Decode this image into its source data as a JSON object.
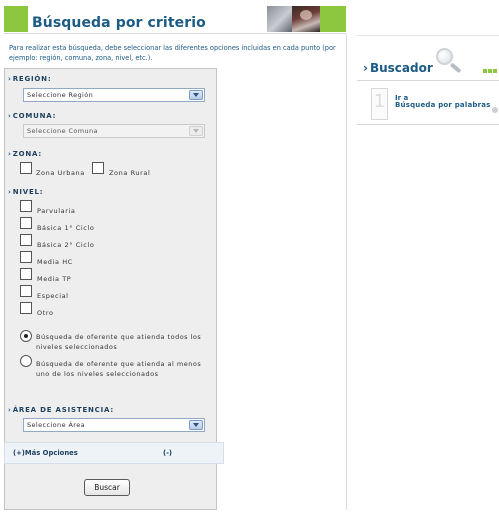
{
  "header": {
    "title": "Búsqueda por criterio",
    "instructions": "Para realizar esta búsqueda, debe seleccionar las diferentes opciones incluidas en cada punto (por ejemplo: región, comuna, zona, nivel, etc.)."
  },
  "form": {
    "region": {
      "label": "REGIÓN:",
      "selected": "Seleccione Región",
      "enabled": true
    },
    "comuna": {
      "label": "COMUNA:",
      "selected": "Seleccione Comuna",
      "enabled": false
    },
    "zona": {
      "label": "ZONA:",
      "options": [
        {
          "label": "Zona Urbana",
          "checked": false
        },
        {
          "label": "Zona Rural",
          "checked": false
        }
      ]
    },
    "nivel": {
      "label": "NIVEL:",
      "options": [
        {
          "label": "Parvularia",
          "checked": false
        },
        {
          "label": "Básica 1° Ciclo",
          "checked": false
        },
        {
          "label": "Básica 2° Ciclo",
          "checked": false
        },
        {
          "label": "Media HC",
          "checked": false
        },
        {
          "label": "Media TP",
          "checked": false
        },
        {
          "label": "Especial",
          "checked": false
        },
        {
          "label": "Otro",
          "checked": false
        }
      ]
    },
    "match_mode": {
      "options": [
        {
          "label": "Búsqueda de oferente que atienda todos los niveles seleccionados",
          "selected": true
        },
        {
          "label": "Búsqueda de oferente que atienda al menos uno de los niveles seleccionados",
          "selected": false
        }
      ]
    },
    "area": {
      "label": "ÁREA DE ASISTENCIA:",
      "selected": "Seleccione Área",
      "enabled": true
    },
    "more_options": "(+)Más Opciones",
    "less_options": "(-)",
    "submit": "Buscar"
  },
  "sidebar": {
    "title": "Buscador",
    "item": {
      "number": "1",
      "line1": "Ir a",
      "line2": "Búsqueda por palabras"
    }
  },
  "colors": {
    "brand_green": "#8dc63f",
    "brand_blue": "#1c5b86",
    "panel_bg": "#eeeeee"
  },
  "icons": {
    "section_marker": "chevron-right-icon",
    "sidebar_logo": "magnifier-icon"
  }
}
